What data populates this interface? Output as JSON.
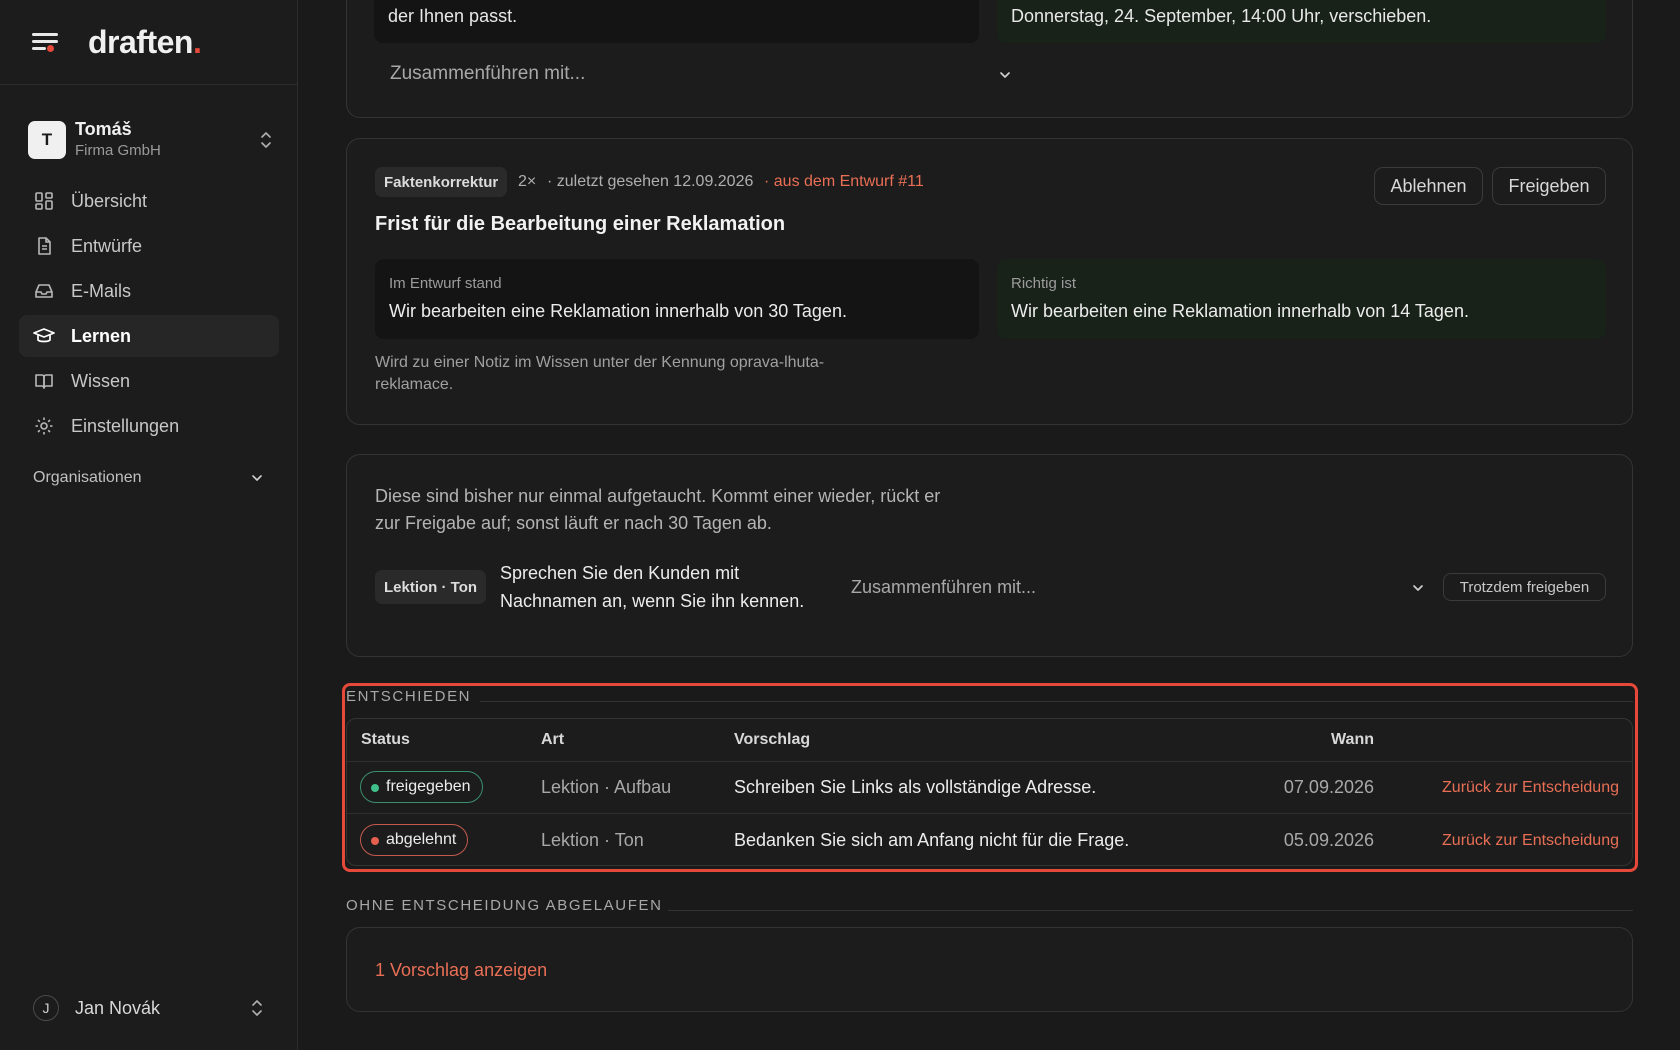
{
  "brand": {
    "name": "draften",
    "dot": "."
  },
  "account": {
    "initial": "T",
    "name": "Tomáš",
    "org": "Firma GmbH"
  },
  "nav": [
    {
      "label": "Übersicht",
      "icon": "grid-icon"
    },
    {
      "label": "Entwürfe",
      "icon": "document-icon"
    },
    {
      "label": "E-Mails",
      "icon": "inbox-icon"
    },
    {
      "label": "Lernen",
      "icon": "graduation-cap-icon",
      "active": true
    },
    {
      "label": "Wissen",
      "icon": "book-icon"
    },
    {
      "label": "Einstellungen",
      "icon": "gear-icon"
    }
  ],
  "organizations_label": "Organisationen",
  "user": {
    "initial": "J",
    "name": "Jan Novák"
  },
  "top_card": {
    "left_text": "der Ihnen passt.",
    "right_text": "Donnerstag, 24. September, 14:00 Uhr, verschieben.",
    "merge_label": "Zusammenführen mit..."
  },
  "fact_card": {
    "tag": "Faktenkorrektur",
    "count": "2×",
    "last_seen": "· zuletzt gesehen 12.09.2026",
    "source": "· aus dem Entwurf #11",
    "reject_label": "Ablehnen",
    "approve_label": "Freigeben",
    "title": "Frist für die Bearbeitung einer Reklamation",
    "draft_label": "Im Entwurf stand",
    "draft_text": "Wir bearbeiten eine Reklamation innerhalb von 30 Tagen.",
    "correct_label": "Richtig ist",
    "correct_text": "Wir bearbeiten eine Reklamation innerhalb von 14 Tagen.",
    "note_line1": "Wird zu einer Notiz im Wissen unter der Kennung oprava-lhuta-",
    "note_line2": "reklamace."
  },
  "once_card": {
    "intro_line1": "Diese sind bisher nur einmal aufgetaucht. Kommt einer wieder, rückt er",
    "intro_line2": "zur Freigabe auf; sonst läuft er nach 30 Tagen ab.",
    "tag": "Lektion · Ton",
    "text_line1": "Sprechen Sie den Kunden mit",
    "text_line2": "Nachnamen an, wenn Sie ihn kennen.",
    "merge_label": "Zusammenführen mit...",
    "force_label": "Trotzdem freigeben"
  },
  "decided": {
    "title": "ENTSCHIEDEN",
    "headers": {
      "status": "Status",
      "art": "Art",
      "vorschlag": "Vorschlag",
      "wann": "Wann"
    },
    "rows": [
      {
        "status": "freigegeben",
        "art": "Lektion · Aufbau",
        "vorschlag": "Schreiben Sie Links als vollständige Adresse.",
        "wann": "07.09.2026",
        "action": "Zurück zur Entscheidung"
      },
      {
        "status": "abgelehnt",
        "art": "Lektion · Ton",
        "vorschlag": "Bedanken Sie sich am Anfang nicht für die Frage.",
        "wann": "05.09.2026",
        "action": "Zurück zur Entscheidung"
      }
    ]
  },
  "expired": {
    "title": "OHNE ENTSCHEIDUNG ABGELAUFEN",
    "show_label": "1 Vorschlag anzeigen"
  },
  "colors": {
    "accent": "#e86f55",
    "brand_red": "#e5493a",
    "approved": "#3fbf8a",
    "rejected": "#e5604f",
    "background": "#1a1a1a"
  }
}
